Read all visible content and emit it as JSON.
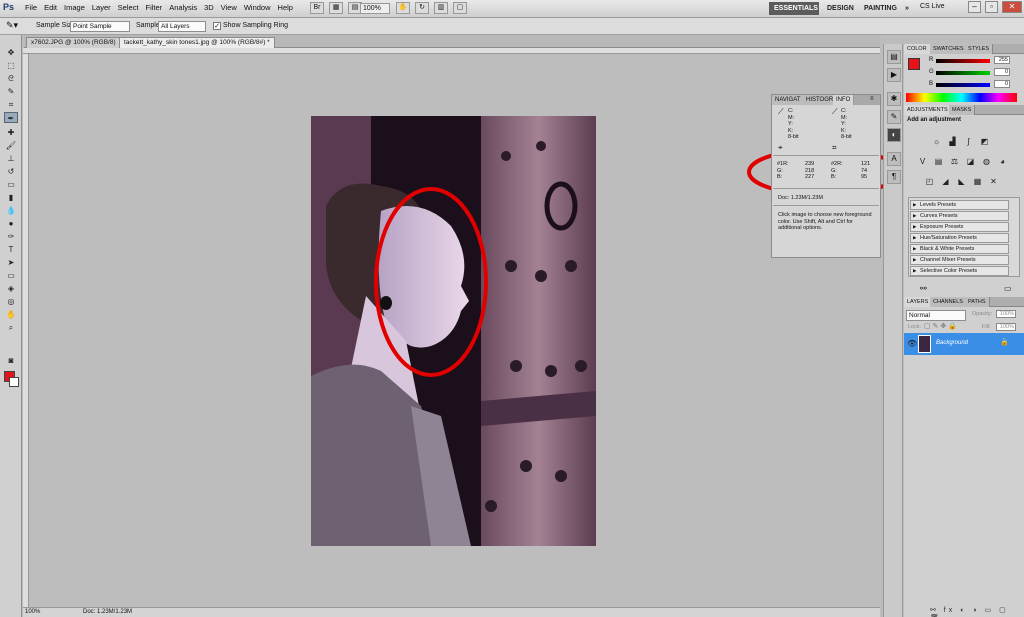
{
  "menubar": {
    "logo": "Ps",
    "menus": [
      "File",
      "Edit",
      "Image",
      "Layer",
      "Select",
      "Filter",
      "Analysis",
      "3D",
      "View",
      "Window",
      "Help"
    ],
    "zoom": "100%",
    "workspaces": {
      "essentials": "ESSENTIALS",
      "design": "DESIGN",
      "painting": "PAINTING",
      "more": "»"
    },
    "cslive": "CS Live"
  },
  "options": {
    "sample_size_label": "Sample Size:",
    "sample_size_value": "Point Sample",
    "sample_label": "Sample:",
    "sample_value": "All Layers",
    "show_ring_label": "Show Sampling Ring"
  },
  "tabs": [
    "x7602.JPG @ 100% (RGB/8)",
    "tackett_kathy_skin tones1.jpg @ 100% (RGB/8#) *"
  ],
  "info_panel": {
    "tabs": [
      "NAVIGAT",
      "HISTOGR",
      "INFO"
    ],
    "cmyk_left": "C:\nM:\nY:\nK:\n8-bit",
    "cmyk_right": "C:\nM:\nY:\nK:\n8-bit",
    "s1": {
      "labels": "#1R:\nG:\nB:",
      "values": "239\n218\n227"
    },
    "s2": {
      "labels": "#2R:\nG:\nB:",
      "values": "121\n74\n95"
    },
    "doc": "Doc: 1.23M/1.23M",
    "help": "Click image to choose new foreground color. Use Shift, Alt and Ctrl for additional options."
  },
  "color_panel": {
    "tabs": [
      "COLOR",
      "SWATCHES",
      "STYLES"
    ],
    "r_label": "R",
    "g_label": "G",
    "b_label": "B",
    "r": "255",
    "g": "0",
    "b": "0",
    "fg_color": "#e4141b"
  },
  "adjustments": {
    "tabs": [
      "ADJUSTMENTS",
      "MASKS"
    ],
    "title": "Add an adjustment",
    "presets": [
      "Levels Presets",
      "Curves Presets",
      "Exposure Presets",
      "Hue/Saturation Presets",
      "Black & White Presets",
      "Channel Mixer Presets",
      "Selective Color Presets"
    ]
  },
  "layers": {
    "tabs": [
      "LAYERS",
      "CHANNELS",
      "PATHS"
    ],
    "blend_mode": "Normal",
    "opacity_label": "Opacity:",
    "opacity": "100%",
    "lock_label": "Lock:",
    "fill_label": "Fill:",
    "fill": "100%",
    "layer_name": "Background"
  },
  "status": {
    "zoom": "100%",
    "doc": "Doc: 1.23M/1.23M"
  },
  "annotation_color": "#e00000"
}
